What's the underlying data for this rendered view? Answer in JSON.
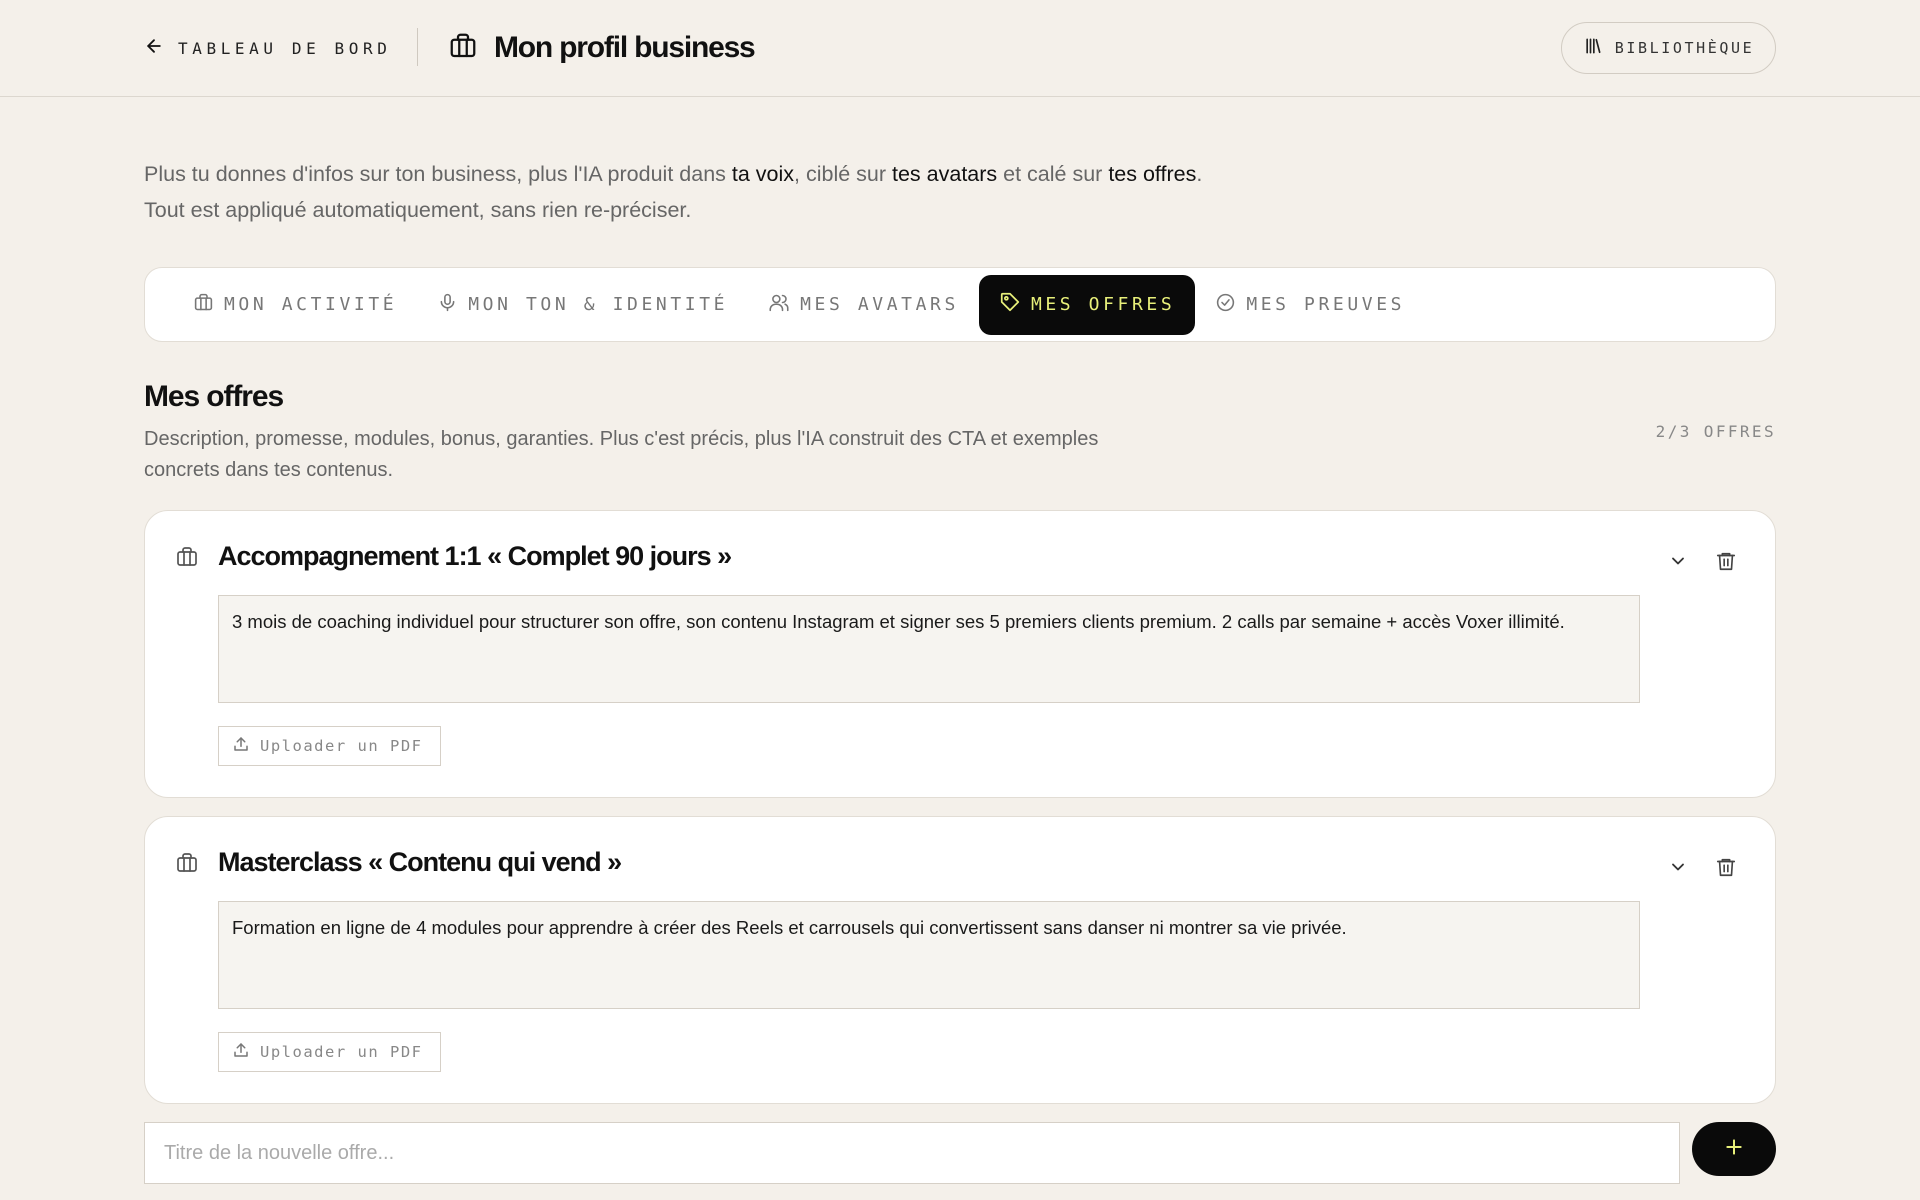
{
  "header": {
    "back_label": "TABLEAU DE BORD",
    "page_title": "Mon profil business",
    "library_label": "BIBLIOTHÈQUE"
  },
  "intro": {
    "line1_part1": "Plus tu donnes d'infos sur ton business, plus l'IA produit dans ",
    "line1_voice": "ta voix",
    "line1_part2": ", ciblé sur ",
    "line1_avatars": "tes avatars",
    "line1_part3": " et calé sur ",
    "line1_offers": "tes offres",
    "line1_end": ".",
    "line2": "Tout est appliqué automatiquement, sans rien re-préciser."
  },
  "tabs": [
    {
      "label": "MON ACTIVITÉ",
      "icon": "briefcase-icon",
      "active": false
    },
    {
      "label": "MON TON & IDENTITÉ",
      "icon": "microphone-icon",
      "active": false
    },
    {
      "label": "MES AVATARS",
      "icon": "users-icon",
      "active": false
    },
    {
      "label": "MES OFFRES",
      "icon": "tag-icon",
      "active": true
    },
    {
      "label": "MES PREUVES",
      "icon": "check-circle-icon",
      "active": false
    }
  ],
  "section": {
    "title": "Mes offres",
    "description": "Description, promesse, modules, bonus, garanties. Plus c'est précis, plus l'IA construit des CTA et exemples concrets dans tes contenus.",
    "count": "2/3 OFFRES"
  },
  "offers": [
    {
      "title": "Accompagnement 1:1 « Complet 90 jours »",
      "description": "3 mois de coaching individuel pour structurer son offre, son contenu Instagram et signer ses 5 premiers clients premium. 2 calls par semaine + accès Voxer illimité.",
      "upload_label": "Uploader un PDF"
    },
    {
      "title": "Masterclass « Contenu qui vend »",
      "description": "Formation en ligne de 4 modules pour apprendre à créer des Reels et carrousels qui convertissent sans danser ni montrer sa vie privée.",
      "upload_label": "Uploader un PDF"
    }
  ],
  "new_offer": {
    "placeholder": "Titre de la nouvelle offre...",
    "value": ""
  },
  "colors": {
    "background": "#f4f0ea",
    "card": "#ffffff",
    "accent_dark": "#0a0a0a",
    "active_tab_text": "#e8f07a",
    "muted_text": "#666666"
  }
}
